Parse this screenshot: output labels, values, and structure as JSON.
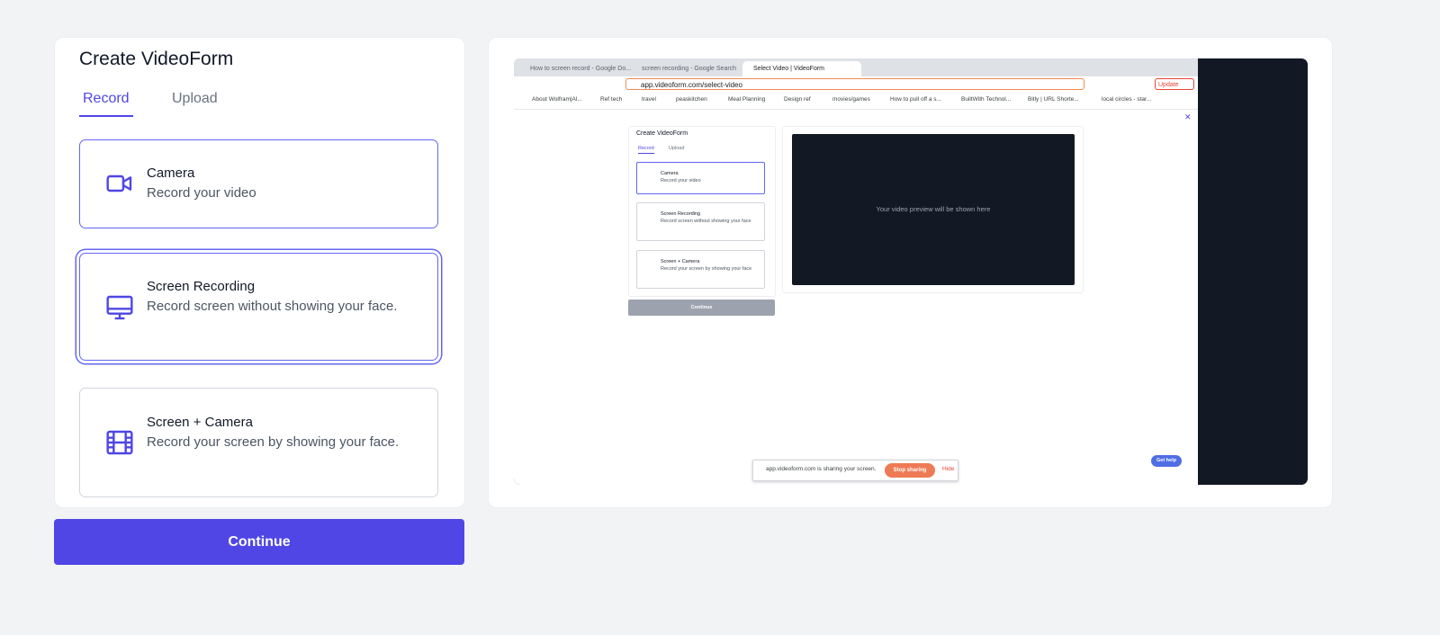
{
  "form": {
    "title": "Create VideoForm",
    "tabs": [
      {
        "label": "Record",
        "active": true
      },
      {
        "label": "Upload",
        "active": false
      }
    ],
    "options": [
      {
        "icon": "video-camera-icon",
        "title": "Camera",
        "subtitle": "Record your video",
        "state": "selected"
      },
      {
        "icon": "monitor-icon",
        "title": "Screen Recording",
        "subtitle": "Record screen without showing your face.",
        "state": "focused"
      },
      {
        "icon": "film-icon",
        "title": "Screen + Camera",
        "subtitle": "Record your screen by showing your face.",
        "state": "default"
      }
    ],
    "continue_label": "Continue"
  },
  "colors": {
    "accent": "#4f46e5",
    "page_bg": "#f2f3f5",
    "preview_bg": "#131924",
    "stop_sharing": "#ee7b55"
  },
  "preview": {
    "tabs": [
      "How to screen record - Google Do...",
      "screen recording - Google Search",
      "Select Video | VideoForm"
    ],
    "url": "app.videoform.com/select-video",
    "update_label": "Update",
    "bookmarks": [
      "About Wolfram|Al...",
      "Ref tech",
      "travel",
      "peaskitchen",
      "Meal Planning",
      "Design ref",
      "movies/games",
      "How to pull off a s...",
      "BuiltWith Technol...",
      "Bitly | URL Shorte...",
      "local circles - star..."
    ],
    "mini_title": "Create VideoForm",
    "mini_tabs": [
      "Record",
      "Upload"
    ],
    "mini_options": [
      {
        "title": "Camera",
        "subtitle": "Record your video"
      },
      {
        "title": "Screen Recording",
        "subtitle": "Record screen without showing your face"
      },
      {
        "title": "Screen + Camera",
        "subtitle": "Record your screen by showing your face"
      }
    ],
    "mini_continue": "Continue",
    "video_placeholder": "Your video preview will be shown here",
    "share_text": "app.videoform.com is sharing your screen.",
    "stop_sharing": "Stop sharing",
    "hide": "Hide",
    "get_help": "Get help"
  }
}
